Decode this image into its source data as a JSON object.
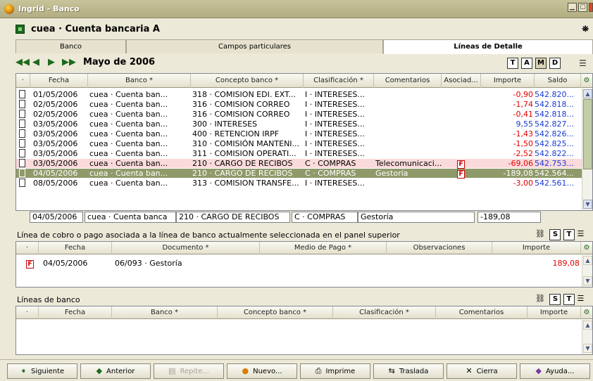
{
  "window": {
    "title": "Ingrid - Banco"
  },
  "doc": {
    "title": "cuea · Cuenta bancaria A",
    "binoculars": "⛯"
  },
  "tabs": [
    {
      "label": "Banco"
    },
    {
      "label": "Campos particulares"
    },
    {
      "label": "Líneas de Detalle"
    }
  ],
  "nav": {
    "month": "Mayo de 2006",
    "toggles": [
      "T",
      "A",
      "M",
      "D"
    ]
  },
  "top_grid": {
    "columns": [
      "·",
      "Fecha",
      "Banco *",
      "Concepto banco *",
      "Clasificación *",
      "Comentarios",
      "Asociad...",
      "Importe",
      "Saldo"
    ],
    "rows": [
      {
        "fecha": "01/05/2006",
        "banco": "cuea · Cuenta ban...",
        "concepto": "318 · COMISION EDI. EXT...",
        "clasif": "I · INTERESES...",
        "coment": "",
        "asoc": "",
        "importe": "-0,90",
        "saldo": "542.820...",
        "style": "normal"
      },
      {
        "fecha": "02/05/2006",
        "banco": "cuea · Cuenta ban...",
        "concepto": "316 · COMISION CORREO",
        "clasif": "I · INTERESES...",
        "coment": "",
        "asoc": "",
        "importe": "-1,74",
        "saldo": "542.818...",
        "style": "normal"
      },
      {
        "fecha": "02/05/2006",
        "banco": "cuea · Cuenta ban...",
        "concepto": "316 · COMISION CORREO",
        "clasif": "I · INTERESES...",
        "coment": "",
        "asoc": "",
        "importe": "-0,41",
        "saldo": "542.818...",
        "style": "normal"
      },
      {
        "fecha": "03/05/2006",
        "banco": "cuea · Cuenta ban...",
        "concepto": "300 · INTERESES",
        "clasif": "I · INTERESES...",
        "coment": "",
        "asoc": "",
        "importe": "9,55",
        "saldo": "542.827...",
        "style": "normal"
      },
      {
        "fecha": "03/05/2006",
        "banco": "cuea · Cuenta ban...",
        "concepto": "400 · RETENCION IRPF",
        "clasif": "I · INTERESES...",
        "coment": "",
        "asoc": "",
        "importe": "-1,43",
        "saldo": "542.826...",
        "style": "normal"
      },
      {
        "fecha": "03/05/2006",
        "banco": "cuea · Cuenta ban...",
        "concepto": "310 · COMISIÓN MANTENI...",
        "clasif": "I · INTERESES...",
        "coment": "",
        "asoc": "",
        "importe": "-1,50",
        "saldo": "542.825...",
        "style": "normal"
      },
      {
        "fecha": "03/05/2006",
        "banco": "cuea · Cuenta ban...",
        "concepto": "311 · COMISION OPERATI...",
        "clasif": "I · INTERESES...",
        "coment": "",
        "asoc": "",
        "importe": "-2,52",
        "saldo": "542.822...",
        "style": "normal"
      },
      {
        "fecha": "03/05/2006",
        "banco": "cuea · Cuenta ban...",
        "concepto": "210 · CARGO DE RECIBOS",
        "clasif": "C · COMPRAS",
        "coment": "Telecomunicaci...",
        "asoc": "F",
        "importe": "-69,06",
        "saldo": "542.753...",
        "style": "pink"
      },
      {
        "fecha": "04/05/2006",
        "banco": "cuea · Cuenta ban...",
        "concepto": "210 · CARGO DE RECIBOS",
        "clasif": "C · COMPRAS",
        "coment": "Gestoría",
        "asoc": "F",
        "importe": "-189,08",
        "saldo": "542.564...",
        "style": "sel"
      },
      {
        "fecha": "08/05/2006",
        "banco": "cuea · Cuenta ban...",
        "concepto": "313 · COMISION TRANSFE...",
        "clasif": "I · INTERESES...",
        "coment": "",
        "asoc": "",
        "importe": "-3,00",
        "saldo": "542.561...",
        "style": "normal"
      }
    ]
  },
  "edit_row": {
    "fecha": "04/05/2006",
    "banco": "cuea · Cuenta banca",
    "concepto": "210 · CARGO DE RECIBOS",
    "clasif": "C · COMPRAS",
    "coment": "Gestoría",
    "importe": "-189,08"
  },
  "linked": {
    "label": "Línea de cobro o pago asociada a la línea de banco actualmente seleccionada en el panel superior",
    "columns": [
      "·",
      "Fecha",
      "Documento *",
      "Medio de Pago *",
      "Observaciones",
      "Importe"
    ],
    "rows": [
      {
        "fecha": "04/05/2006",
        "documento": "06/093 · Gestoría",
        "medio": "",
        "obs": "",
        "importe": "189,08"
      }
    ],
    "icons": [
      "S",
      "T"
    ]
  },
  "bank_lines": {
    "label": "Líneas de banco",
    "columns": [
      "·",
      "Fecha",
      "Banco *",
      "Concepto banco *",
      "Clasificación *",
      "Comentarios",
      "Importe"
    ],
    "icons": [
      "S",
      "T"
    ]
  },
  "buttons": [
    {
      "label": "Siguiente",
      "icon": "➧"
    },
    {
      "label": "Anterior",
      "icon": "◆"
    },
    {
      "label": "Repite...",
      "icon": "▤"
    },
    {
      "label": "Nuevo...",
      "icon": "●"
    },
    {
      "label": "Imprime",
      "icon": "⎙"
    },
    {
      "label": "Traslada",
      "icon": "⇆"
    },
    {
      "label": "Cierra",
      "icon": "✕"
    },
    {
      "label": "Ayuda...",
      "icon": "◆"
    }
  ],
  "colors": {
    "negative": "#e00000",
    "positive": "#1a3ad0",
    "selected_row": "#8f9a6a",
    "pink_row": "#fadadb"
  }
}
